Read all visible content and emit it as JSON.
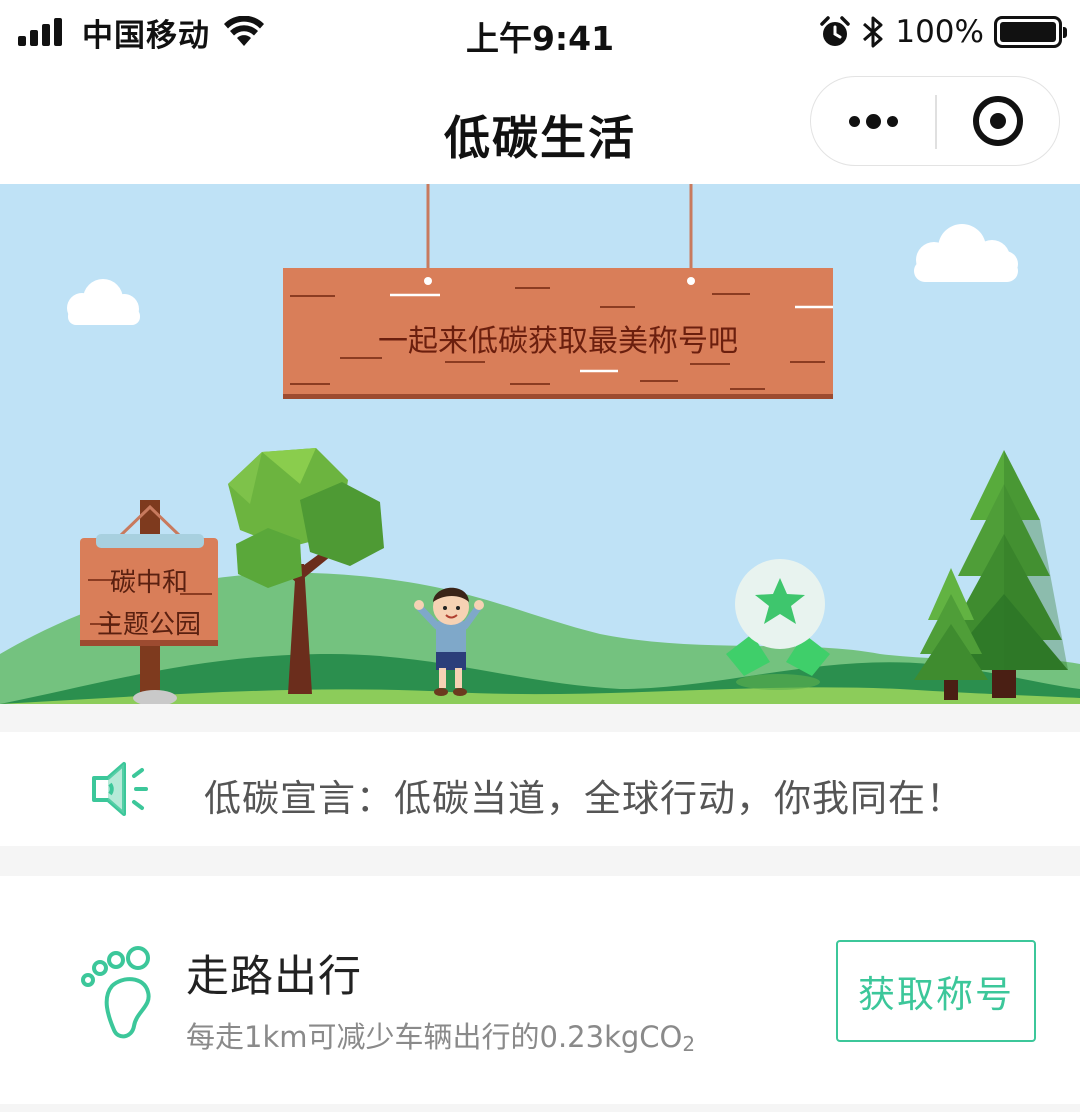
{
  "status_bar": {
    "carrier": "中国移动",
    "time": "上午9:41",
    "battery_percent": "100%",
    "icons": [
      "signal-icon",
      "wifi-icon",
      "alarm-icon",
      "bluetooth-icon",
      "battery-icon"
    ]
  },
  "nav": {
    "title": "低碳生活",
    "more_icon": "more-dots-icon",
    "close_icon": "close-target-icon"
  },
  "banner": {
    "board_text": "一起来低碳获取最美称号吧",
    "sign_line1": "碳中和",
    "sign_line2": "主题公园"
  },
  "slogan": {
    "icon": "speaker-icon",
    "text": "低碳宣言：低碳当道，全球行动，你我同在！"
  },
  "card": {
    "icon": "footprint-icon",
    "title": "走路出行",
    "desc_main": "每走1km可减少车辆出行的0.23kgCO",
    "desc_sub": "2",
    "button_label": "获取称号"
  },
  "colors": {
    "accent": "#3cc79a",
    "sky": "#bfe2f6",
    "board": "#d97e59"
  }
}
